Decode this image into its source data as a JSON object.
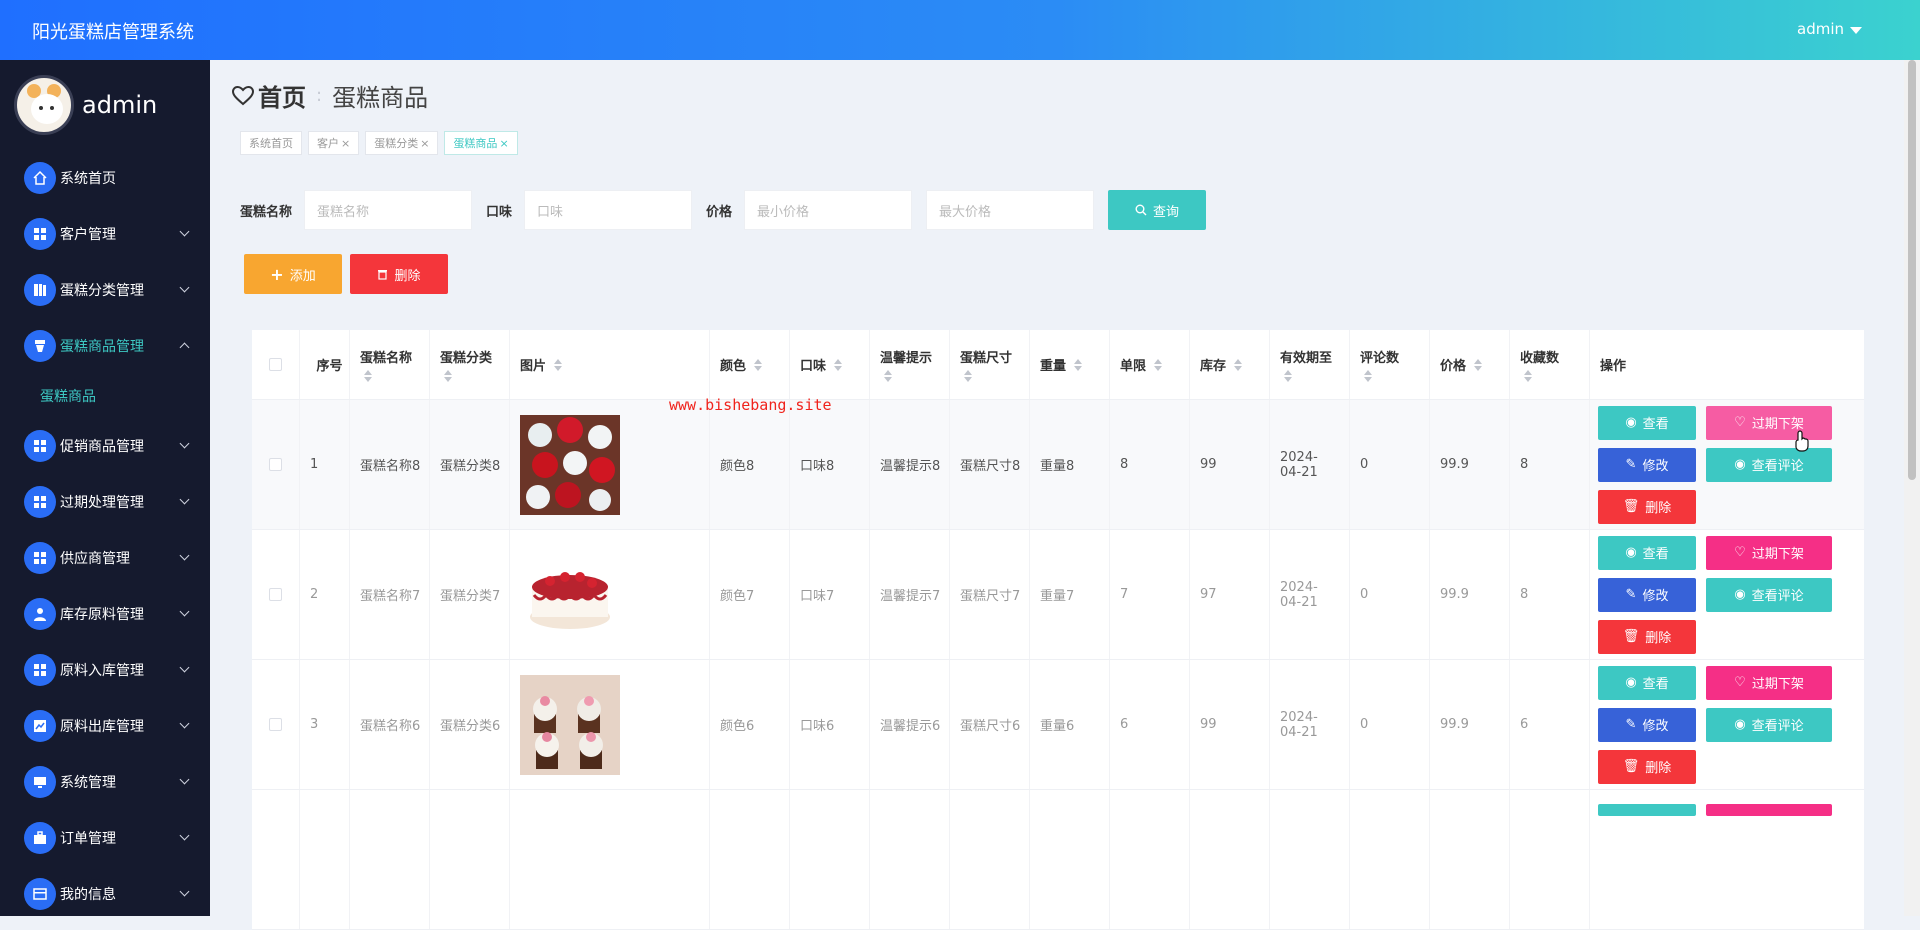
{
  "app": {
    "title": "阳光蛋糕店管理系统",
    "user": "admin"
  },
  "profile": {
    "name": "admin"
  },
  "sidebar": {
    "items": [
      {
        "label": "系统首页",
        "icon": "home-icon"
      },
      {
        "label": "客户管理",
        "icon": "grid-icon"
      },
      {
        "label": "蛋糕分类管理",
        "icon": "book-icon"
      },
      {
        "label": "蛋糕商品管理",
        "icon": "cup-icon",
        "active": true
      },
      {
        "label": "促销商品管理",
        "icon": "grid-icon"
      },
      {
        "label": "过期处理管理",
        "icon": "grid-icon"
      },
      {
        "label": "供应商管理",
        "icon": "grid-icon"
      },
      {
        "label": "库存原料管理",
        "icon": "user-icon"
      },
      {
        "label": "原料入库管理",
        "icon": "grid-icon"
      },
      {
        "label": "原料出库管理",
        "icon": "chart-icon"
      },
      {
        "label": "系统管理",
        "icon": "monitor-icon"
      },
      {
        "label": "订单管理",
        "icon": "bag-icon"
      },
      {
        "label": "我的信息",
        "icon": "card-icon"
      }
    ],
    "submenu": "蛋糕商品"
  },
  "heading": {
    "home": "首页",
    "page": "蛋糕商品"
  },
  "tabs": [
    {
      "label": "系统首页",
      "close": ""
    },
    {
      "label": "客户",
      "close": "×"
    },
    {
      "label": "蛋糕分类",
      "close": "×"
    },
    {
      "label": "蛋糕商品",
      "close": "×"
    }
  ],
  "search": {
    "name_label": "蛋糕名称",
    "name_placeholder": "蛋糕名称",
    "taste_label": "口味",
    "taste_placeholder": "口味",
    "price_label": "价格",
    "min_placeholder": "最小价格",
    "max_placeholder": "最大价格",
    "query_label": "查询"
  },
  "actions": {
    "add": "添加",
    "delete": "删除"
  },
  "table": {
    "headers": [
      "序号",
      "蛋糕名称",
      "蛋糕分类",
      "图片",
      "颜色",
      "口味",
      "温馨提示",
      "蛋糕尺寸",
      "重量",
      "单限",
      "库存",
      "有效期至",
      "评论数",
      "价格",
      "收藏数",
      "操作"
    ],
    "rows": [
      {
        "no": "1",
        "name": "蛋糕名称8",
        "category": "蛋糕分类8",
        "color": "颜色8",
        "taste": "口味8",
        "tip": "温馨提示8",
        "size": "蛋糕尺寸8",
        "weight": "重量8",
        "limit": "8",
        "stock": "99",
        "expire": "2024-04-21",
        "comments": "0",
        "price": "99.9",
        "favorites": "8"
      },
      {
        "no": "2",
        "name": "蛋糕名称7",
        "category": "蛋糕分类7",
        "color": "颜色7",
        "taste": "口味7",
        "tip": "温馨提示7",
        "size": "蛋糕尺寸7",
        "weight": "重量7",
        "limit": "7",
        "stock": "97",
        "expire": "2024-04-21",
        "comments": "0",
        "price": "99.9",
        "favorites": "8"
      },
      {
        "no": "3",
        "name": "蛋糕名称6",
        "category": "蛋糕分类6",
        "color": "颜色6",
        "taste": "口味6",
        "tip": "温馨提示6",
        "size": "蛋糕尺寸6",
        "weight": "重量6",
        "limit": "6",
        "stock": "99",
        "expire": "2024-04-21",
        "comments": "0",
        "price": "99.9",
        "favorites": "6"
      }
    ],
    "ops": {
      "view": "查看",
      "expire": "过期下架",
      "edit": "修改",
      "comments": "查看评论",
      "delete": "删除"
    }
  },
  "watermark": "www.bishebang.site",
  "colors": {
    "accent": "#3dc8c3",
    "sidebar": "#151a2e",
    "danger": "#f4363b",
    "warning": "#f8a630",
    "primary": "#3762d8",
    "pink": "#f52f86"
  }
}
